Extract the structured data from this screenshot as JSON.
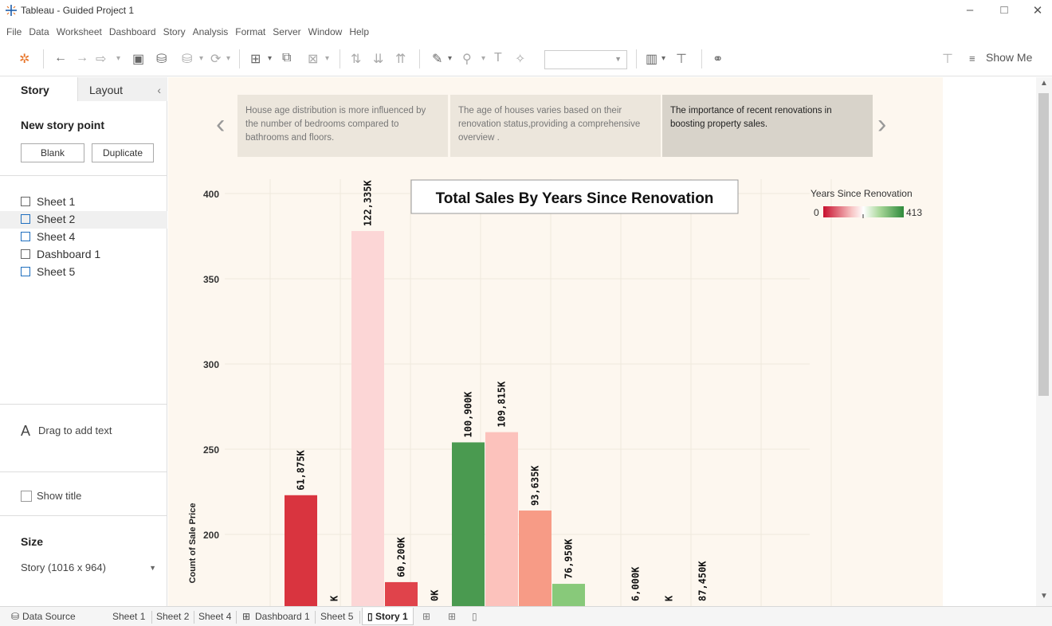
{
  "window": {
    "title": "Tableau - Guided Project 1",
    "min": "–",
    "restore": "□",
    "close": "✕"
  },
  "menu": [
    "File",
    "Data",
    "Worksheet",
    "Dashboard",
    "Story",
    "Analysis",
    "Format",
    "Server",
    "Window",
    "Help"
  ],
  "toolbar": {
    "show_me": "Show Me"
  },
  "left_panel": {
    "tab_story": "Story",
    "tab_layout": "Layout",
    "new_story_point": "New story point",
    "blank_button": "Blank",
    "duplicate_button": "Duplicate",
    "sheets": [
      "Sheet 1",
      "Sheet 2",
      "Sheet 4",
      "Dashboard 1",
      "Sheet 5"
    ],
    "drag_text": "Drag to add text",
    "show_title": "Show title",
    "size_heading": "Size",
    "size_value": "Story (1016 x 964)"
  },
  "story_points": [
    "House age distribution is more influenced by the number of bedrooms compared to bathrooms and floors.",
    "The age of houses varies based on their renovation status,providing a comprehensive overview .",
    "The importance of recent renovations in boosting property sales."
  ],
  "legend": {
    "title": "Years Since Renovation",
    "min": "0",
    "max": "413"
  },
  "colors": {
    "canvas_bg": "#fdf7ef",
    "dark_red": "#d9343f",
    "light_pink": "#fcd6d6",
    "dark_green": "#4a9a50",
    "light_green": "#88c97a"
  },
  "chart_data": {
    "type": "bar",
    "title": "Total Sales By Years Since Renovation",
    "ylabel": "Count of Sale Price",
    "ylim": [
      150,
      400
    ],
    "yticks": [
      200,
      250,
      300,
      350,
      400
    ],
    "bars": [
      {
        "count": 155,
        "label": "",
        "color": "#d9343f"
      },
      {
        "count": 223,
        "label": "61,875K",
        "color": "#d9343f"
      },
      {
        "count": 150,
        "label": "K",
        "color": "#f7b6b1"
      },
      {
        "count": 378,
        "label": "122,335K",
        "color": "#fcd6d6"
      },
      {
        "count": 172,
        "label": "60,200K",
        "color": "#e0434b"
      },
      {
        "count": 150,
        "label": "0K",
        "color": "#f5a39b"
      },
      {
        "count": 254,
        "label": "100,900K",
        "color": "#4a9a50"
      },
      {
        "count": 260,
        "label": "109,815K",
        "color": "#fcc2bc"
      },
      {
        "count": 214,
        "label": "93,635K",
        "color": "#f79b86"
      },
      {
        "count": 171,
        "label": "76,950K",
        "color": "#88c97a"
      },
      {
        "count": 150,
        "label": "",
        "color": "#f5a39b"
      },
      {
        "count": 150,
        "label": "6,000K",
        "color": "#c9e6bf"
      },
      {
        "count": 150,
        "label": "K",
        "color": "#f5a39b"
      },
      {
        "count": 152,
        "label": "87,450K",
        "color": "#2f7d3a"
      }
    ]
  },
  "bottom_tabs": [
    "Data Source",
    "Sheet 1",
    "Sheet 2",
    "Sheet 4",
    "Dashboard 1",
    "Sheet 5",
    "Story 1"
  ]
}
